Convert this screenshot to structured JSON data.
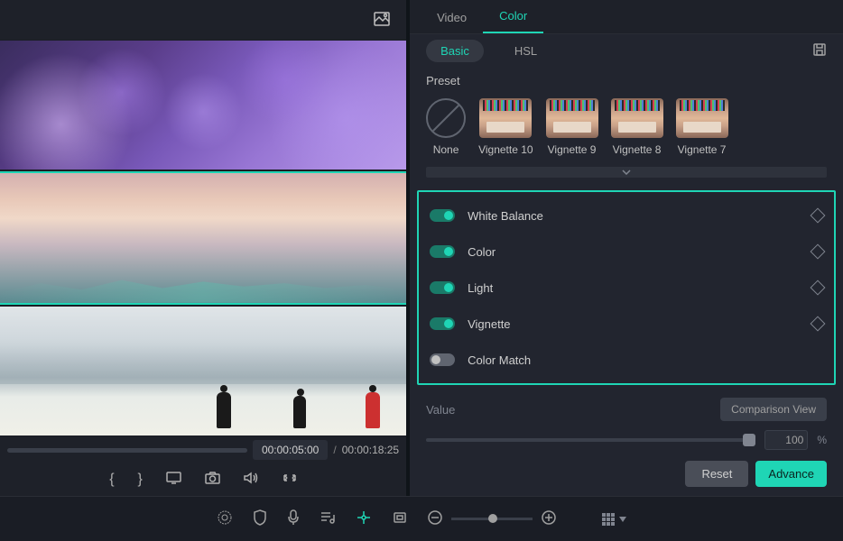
{
  "tabs": {
    "video": "Video",
    "color": "Color"
  },
  "subtabs": {
    "basic": "Basic",
    "hsl": "HSL"
  },
  "preset": {
    "label": "Preset",
    "items": [
      "None",
      "Vignette 10",
      "Vignette 9",
      "Vignette 8",
      "Vignette 7"
    ]
  },
  "toggles": {
    "white_balance": "White Balance",
    "color": "Color",
    "light": "Light",
    "vignette": "Vignette",
    "color_match": "Color Match"
  },
  "value": {
    "label": "Value",
    "comparison": "Comparison View",
    "amount": "100",
    "pct": "%"
  },
  "footer": {
    "reset": "Reset",
    "advance": "Advance"
  },
  "timecode": {
    "current": "00:00:05:00",
    "sep": "/",
    "total": "00:00:18:25"
  }
}
